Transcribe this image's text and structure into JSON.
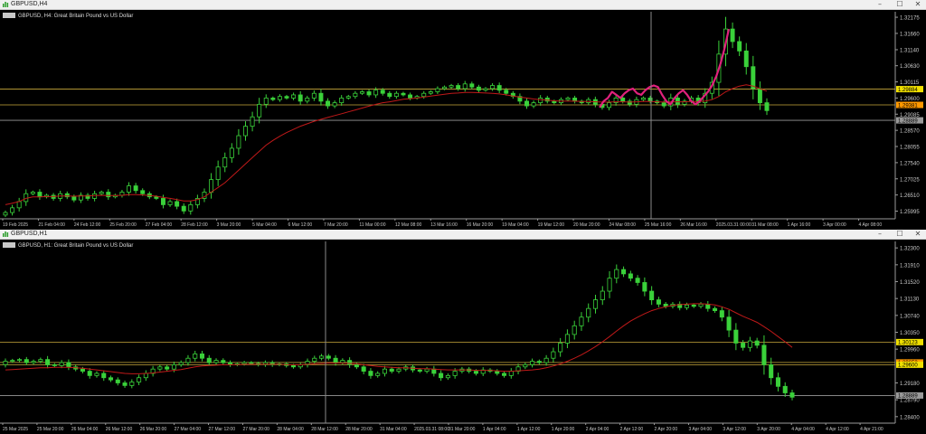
{
  "colors": {
    "background": "#000000",
    "bull": "#3ad13a",
    "bear": "#3ad13a",
    "ma": "#c01919",
    "grid_text": "#c8c8c8",
    "hline": "#c8a83c",
    "label_yellow": "#f0e000",
    "label_orange": "#ff9900",
    "label_gray": "#9a9a9a",
    "drawing": "#e0217c",
    "crosshair": "#8a8a8a"
  },
  "windows": [
    {
      "title": "GBPUSD,H4",
      "controls": {
        "minimize": "–",
        "maximize": "☐",
        "close": "✕"
      },
      "chart_label": "GBPUSD, H4:  Great Britain Pound vs US Dollar",
      "y_ticks": [
        "1.32175",
        "1.31660",
        "1.31140",
        "1.30630",
        "1.30115",
        "1.29600",
        "1.29085",
        "1.28570",
        "1.28055",
        "1.27540",
        "1.27025",
        "1.26510",
        "1.25995"
      ],
      "price_labels": [
        {
          "text": "1.29884",
          "kind": "yellow"
        },
        {
          "text": "1.29381",
          "kind": "orange"
        },
        {
          "text": "1.28889",
          "kind": "gray"
        }
      ],
      "x_labels": [
        "19 Feb 2025",
        "21 Feb 04:00",
        "24 Feb 12:00",
        "25 Feb 20:00",
        "27 Feb 04:00",
        "28 Feb 12:00",
        "3 Mar 20:00",
        "5 Mar 04:00",
        "6 Mar 12:00",
        "7 Mar 20:00",
        "11 Mar 00:00",
        "12 Mar 08:00",
        "13 Mar 16:00",
        "16 Mar 20:00",
        "19 Mar 04:00",
        "19 Mar 12:00",
        "20 Mar 20:00",
        "24 Mar 08:00",
        "25 Mar 16:00",
        "26 Mar 16:00",
        "2025.03.31 00:00",
        "31 Mar 08:00",
        "1 Apr 16:00",
        "3 Apr 00:00",
        "4 Apr 08:00"
      ]
    },
    {
      "title": "GBPUSD,H1",
      "controls": {
        "minimize": "–",
        "maximize": "☐",
        "close": "✕"
      },
      "chart_label": "GBPUSD, H1:  Great Britain Pound vs US Dollar",
      "y_ticks": [
        "1.32300",
        "1.31910",
        "1.31520",
        "1.31130",
        "1.30740",
        "1.30350",
        "1.29960",
        "1.29180",
        "1.28790",
        "1.28400"
      ],
      "price_labels": [
        {
          "text": "1.30123",
          "kind": "yellow"
        },
        {
          "text": "1.29653",
          "kind": "orange"
        },
        {
          "text": "1.29600",
          "kind": "yellow"
        },
        {
          "text": "1.28889",
          "kind": "gray"
        }
      ],
      "x_labels": [
        "25 Mar 2025",
        "25 Mar 20:00",
        "26 Mar 04:00",
        "26 Mar 12:00",
        "26 Mar 20:00",
        "27 Mar 04:00",
        "27 Mar 12:00",
        "27 Mar 20:00",
        "28 Mar 04:00",
        "28 Mar 12:00",
        "28 Mar 20:00",
        "31 Mar 04:00",
        "2025.03.31 08:00",
        "31 Mar 20:00",
        "1 Apr 04:00",
        "1 Apr 12:00",
        "1 Apr 20:00",
        "2 Apr 04:00",
        "2 Apr 12:00",
        "2 Apr 20:00",
        "3 Apr 04:00",
        "3 Apr 12:00",
        "3 Apr 20:00",
        "4 Apr 04:00",
        "4 Apr 12:00",
        "4 Apr 21:00"
      ]
    }
  ],
  "chart_data": [
    {
      "type": "line",
      "title": "GBPUSD, H4:  Great Britain Pound vs US Dollar",
      "ylim": [
        1.2575,
        1.3235
      ],
      "series": [
        {
          "values": [
            1.2595,
            1.261,
            1.263,
            1.2655,
            1.266,
            1.2645,
            1.265,
            1.264,
            1.2655,
            1.2645,
            1.2635,
            1.265,
            1.264,
            1.2655,
            1.266,
            1.2645,
            1.265,
            1.266,
            1.268,
            1.2665,
            1.2655,
            1.2645,
            1.264,
            1.262,
            1.263,
            1.2615,
            1.26,
            1.262,
            1.264,
            1.266,
            1.27,
            1.274,
            1.277,
            1.28,
            1.284,
            1.287,
            1.29,
            1.294,
            1.296,
            1.2955,
            1.2965,
            1.296,
            1.297,
            1.295,
            1.296,
            1.2975,
            1.295,
            1.2935,
            1.2945,
            1.296,
            1.2965,
            1.2975,
            1.298,
            1.297,
            1.2985,
            1.2975,
            1.2965,
            1.2975,
            1.297,
            1.296,
            1.2965,
            1.2975,
            1.298,
            1.299,
            1.2995,
            1.3,
            1.299,
            1.3005,
            1.2995,
            1.2985,
            1.299,
            1.3,
            1.2985,
            1.2975,
            1.2965,
            1.295,
            1.2935,
            1.2945,
            1.296,
            1.295,
            1.2945,
            1.2955,
            1.296,
            1.295,
            1.2945,
            1.2955,
            1.294,
            1.293,
            1.2945,
            1.296,
            1.295,
            1.294,
            1.2955,
            1.296,
            1.295,
            1.2945,
            1.2935,
            1.296,
            1.294,
            1.295,
            1.296,
            1.2945,
            1.2975,
            1.301,
            1.31,
            1.318,
            1.314,
            1.311,
            1.306,
            1.299,
            1.2945,
            1.292
          ]
        }
      ],
      "ma_values": [
        1.262,
        1.2625,
        1.263,
        1.264,
        1.2645,
        1.2645,
        1.2646,
        1.2646,
        1.2648,
        1.2648,
        1.2647,
        1.2648,
        1.2648,
        1.2649,
        1.265,
        1.2649,
        1.2649,
        1.265,
        1.2652,
        1.2652,
        1.2651,
        1.2649,
        1.2647,
        1.2643,
        1.264,
        1.2636,
        1.2632,
        1.2632,
        1.2636,
        1.2645,
        1.266,
        1.2675,
        1.269,
        1.271,
        1.273,
        1.275,
        1.277,
        1.279,
        1.281,
        1.2825,
        1.2838,
        1.285,
        1.286,
        1.287,
        1.2878,
        1.2886,
        1.2892,
        1.2898,
        1.2904,
        1.291,
        1.2916,
        1.2922,
        1.2928,
        1.2934,
        1.294,
        1.2945,
        1.2948,
        1.2952,
        1.2956,
        1.2958,
        1.296,
        1.2963,
        1.2966,
        1.2969,
        1.2972,
        1.2975,
        1.2976,
        1.2978,
        1.2978,
        1.2977,
        1.2976,
        1.2975,
        1.2973,
        1.297,
        1.2966,
        1.2963,
        1.296,
        1.2957,
        1.2955,
        1.2953,
        1.2951,
        1.295,
        1.295,
        1.295,
        1.2949,
        1.2949,
        1.2948,
        1.2947,
        1.2947,
        1.2948,
        1.2948,
        1.2947,
        1.2948,
        1.2949,
        1.2949,
        1.2948,
        1.2947,
        1.2948,
        1.2948,
        1.2948,
        1.2949,
        1.2949,
        1.295,
        1.2955,
        1.2965,
        1.298,
        1.299,
        1.2998,
        1.3002,
        1.2998,
        1.299,
        1.2982
      ],
      "hlines": [
        1.29884,
        1.29381,
        1.28889
      ],
      "drawing_values": [
        1.293,
        1.295,
        1.296,
        1.298,
        1.297,
        1.296,
        1.2975,
        1.2985,
        1.299,
        1.2975,
        1.297,
        1.2985,
        1.2995,
        1.3,
        1.2995,
        1.297,
        1.295,
        1.294,
        1.296,
        1.2975,
        1.2985,
        1.297,
        1.295,
        1.294,
        1.295,
        1.2965,
        1.298,
        1.3,
        1.303,
        1.307,
        1.312,
        1.318
      ],
      "xlabel": "",
      "ylabel": ""
    },
    {
      "type": "line",
      "title": "GBPUSD, H1:  Great Britain Pound vs US Dollar",
      "ylim": [
        1.2825,
        1.3245
      ],
      "series": [
        {
          "values": [
            1.2968,
            1.297,
            1.2972,
            1.2965,
            1.2968,
            1.2972,
            1.296,
            1.2958,
            1.2965,
            1.2955,
            1.295,
            1.2945,
            1.2935,
            1.294,
            1.293,
            1.2925,
            1.2918,
            1.2912,
            1.292,
            1.293,
            1.294,
            1.295,
            1.2955,
            1.295,
            1.296,
            1.2965,
            1.2975,
            1.2985,
            1.2975,
            1.2965,
            1.297,
            1.2965,
            1.296,
            1.2962,
            1.2965,
            1.2963,
            1.296,
            1.2965,
            1.296,
            1.2962,
            1.2958,
            1.2955,
            1.296,
            1.2968,
            1.2975,
            1.298,
            1.2975,
            1.2965,
            1.297,
            1.296,
            1.2955,
            1.2945,
            1.2935,
            1.294,
            1.295,
            1.2945,
            1.295,
            1.2955,
            1.2948,
            1.2945,
            1.295,
            1.294,
            1.293,
            1.2935,
            1.2945,
            1.295,
            1.2945,
            1.294,
            1.2948,
            1.2945,
            1.294,
            1.2935,
            1.2945,
            1.2955,
            1.296,
            1.2968,
            1.2965,
            1.2975,
            1.299,
            1.301,
            1.303,
            1.305,
            1.307,
            1.309,
            1.311,
            1.313,
            1.316,
            1.318,
            1.317,
            1.316,
            1.315,
            1.313,
            1.311,
            1.31,
            1.3095,
            1.31,
            1.3092,
            1.3098,
            1.3095,
            1.31,
            1.309,
            1.3085,
            1.307,
            1.304,
            1.301,
            1.3,
            1.3015,
            1.3005,
            1.296,
            1.293,
            1.291,
            1.2895,
            1.2885
          ],
          "name": ""
        }
      ],
      "ma_values": [
        1.2948,
        1.2949,
        1.295,
        1.2951,
        1.2952,
        1.2953,
        1.2953,
        1.2954,
        1.2954,
        1.2954,
        1.2953,
        1.2952,
        1.295,
        1.2948,
        1.2946,
        1.2944,
        1.2942,
        1.294,
        1.2939,
        1.2939,
        1.294,
        1.2941,
        1.2943,
        1.2945,
        1.2947,
        1.2949,
        1.2952,
        1.2955,
        1.2957,
        1.2958,
        1.2959,
        1.296,
        1.296,
        1.296,
        1.2961,
        1.2961,
        1.2961,
        1.2961,
        1.2961,
        1.2961,
        1.296,
        1.296,
        1.296,
        1.2961,
        1.2962,
        1.2963,
        1.2964,
        1.2964,
        1.2964,
        1.2963,
        1.2962,
        1.296,
        1.2958,
        1.2956,
        1.2955,
        1.2954,
        1.2953,
        1.2953,
        1.2952,
        1.2951,
        1.2951,
        1.295,
        1.2949,
        1.2948,
        1.2948,
        1.2948,
        1.2948,
        1.2947,
        1.2947,
        1.2947,
        1.2946,
        1.2945,
        1.2945,
        1.2946,
        1.2947,
        1.2948,
        1.295,
        1.2953,
        1.2957,
        1.2962,
        1.2968,
        1.2975,
        1.2983,
        1.2992,
        1.3002,
        1.3013,
        1.3025,
        1.3038,
        1.305,
        1.3061,
        1.307,
        1.3078,
        1.3085,
        1.309,
        1.3094,
        1.3097,
        1.3099,
        1.31,
        1.3101,
        1.3101,
        1.31,
        1.3098,
        1.3094,
        1.3088,
        1.308,
        1.3072,
        1.3065,
        1.3058,
        1.3048,
        1.3037,
        1.3025,
        1.3013,
        1.3
      ],
      "hlines": [
        1.30123,
        1.29653,
        1.296,
        1.28889
      ],
      "xlabel": "",
      "ylabel": ""
    }
  ]
}
